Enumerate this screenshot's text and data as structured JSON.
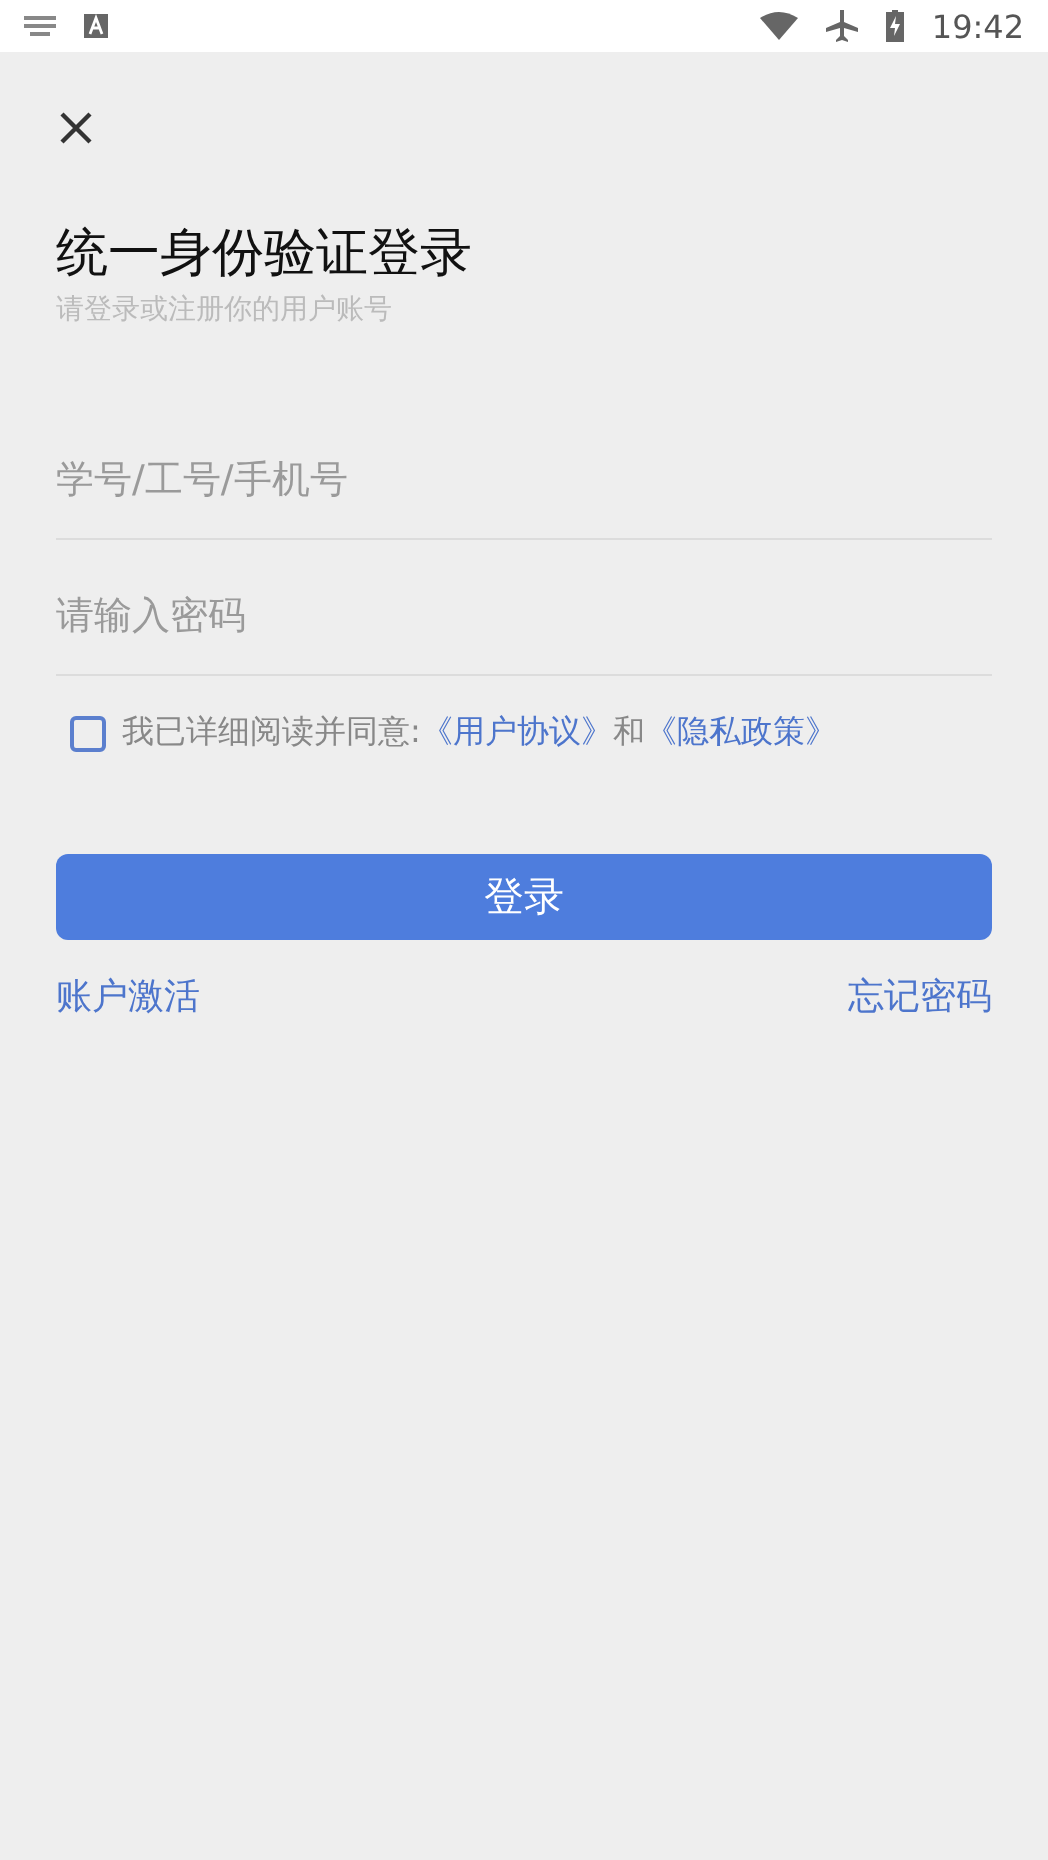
{
  "status_bar": {
    "time": "19:42"
  },
  "title": "统一身份验证登录",
  "subtitle": "请登录或注册你的用户账号",
  "fields": [
    {
      "placeholder": "学号/工号/手机号"
    },
    {
      "placeholder": "请输入密码"
    }
  ],
  "agreement": {
    "checked": false,
    "parts": [
      {
        "kind": "text",
        "text": "我已详细阅读并同意:"
      },
      {
        "kind": "link",
        "text": "《用户协议》"
      },
      {
        "kind": "text",
        "text": "和"
      },
      {
        "kind": "link",
        "text": "《隐私政策》"
      }
    ]
  },
  "login_button": "登录",
  "links": [
    "账户激活",
    "忘记密码"
  ]
}
